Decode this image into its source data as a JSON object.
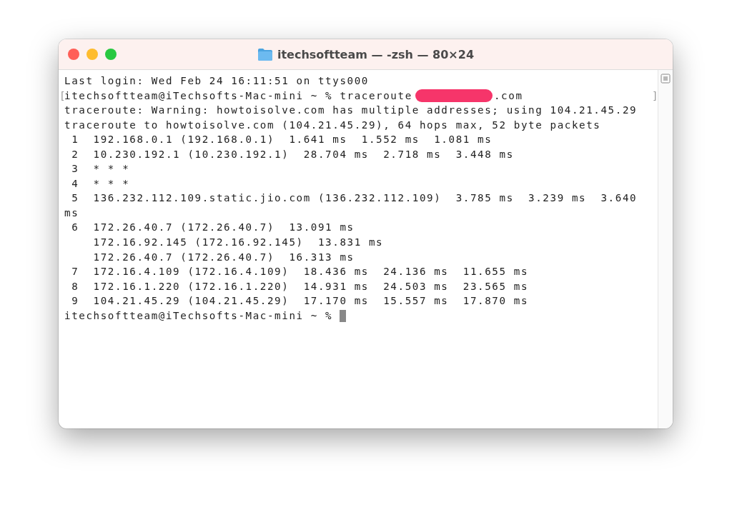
{
  "window": {
    "title": "itechsoftteam — -zsh — 80×24"
  },
  "terminal": {
    "lines": [
      {
        "kind": "text",
        "text": "Last login: Wed Feb 24 16:11:51 on ttys000"
      },
      {
        "kind": "redacted",
        "mark_left": "[",
        "before": "itechsoftteam@iTechsofts-Mac-mini ~ % traceroute ",
        "after": ".com",
        "mark_right": "]"
      },
      {
        "kind": "text",
        "text": "traceroute: Warning: howtoisolve.com has multiple addresses; using 104.21.45.29"
      },
      {
        "kind": "text",
        "text": "traceroute to howtoisolve.com (104.21.45.29), 64 hops max, 52 byte packets"
      },
      {
        "kind": "text",
        "text": " 1  192.168.0.1 (192.168.0.1)  1.641 ms  1.552 ms  1.081 ms"
      },
      {
        "kind": "text",
        "text": " 2  10.230.192.1 (10.230.192.1)  28.704 ms  2.718 ms  3.448 ms"
      },
      {
        "kind": "text",
        "text": " 3  * * *"
      },
      {
        "kind": "text",
        "text": " 4  * * *"
      },
      {
        "kind": "text",
        "text": " 5  136.232.112.109.static.jio.com (136.232.112.109)  3.785 ms  3.239 ms  3.640"
      },
      {
        "kind": "text",
        "text": "ms"
      },
      {
        "kind": "text",
        "text": " 6  172.26.40.7 (172.26.40.7)  13.091 ms"
      },
      {
        "kind": "text",
        "text": "    172.16.92.145 (172.16.92.145)  13.831 ms"
      },
      {
        "kind": "text",
        "text": "    172.26.40.7 (172.26.40.7)  16.313 ms"
      },
      {
        "kind": "text",
        "text": " 7  172.16.4.109 (172.16.4.109)  18.436 ms  24.136 ms  11.655 ms"
      },
      {
        "kind": "text",
        "text": " 8  172.16.1.220 (172.16.1.220)  14.931 ms  24.503 ms  23.565 ms"
      },
      {
        "kind": "text",
        "text": " 9  104.21.45.29 (104.21.45.29)  17.170 ms  15.557 ms  17.870 ms"
      },
      {
        "kind": "prompt",
        "text": "itechsoftteam@iTechsofts-Mac-mini ~ % "
      }
    ]
  }
}
